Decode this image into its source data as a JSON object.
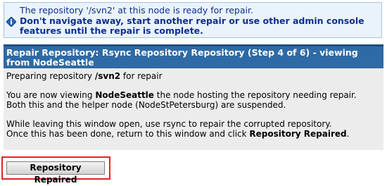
{
  "notice": {
    "line1": "The repository '/svn2' at this node is ready for repair.",
    "line2": "Don't navigate away, start another repair or use other admin console features until the repair is complete.",
    "icon": "info-diamond-icon",
    "color": "#0f2f8f"
  },
  "panel": {
    "title": "Repair Repository: Rsync Repository Repository (Step 4 of 6) - viewing from NodeSeattle",
    "p1": {
      "pre": "Preparing repository ",
      "repo": "/svn2",
      "post": " for repair"
    },
    "p2": {
      "pre": "You are now viewing ",
      "node": "NodeSeattle",
      "post": " the node hosting the repository needing repair.",
      "line2": "Both this and the helper node (NodeStPetersburg) are suspended."
    },
    "p3": {
      "line1": "While leaving this window open, use rsync to repair the corrupted repository.",
      "pre": "Once this has been done, return to this window and click ",
      "button_ref": "Repository Repaired",
      "post": "."
    }
  },
  "actions": {
    "repaired_button": "Repository Repaired"
  }
}
